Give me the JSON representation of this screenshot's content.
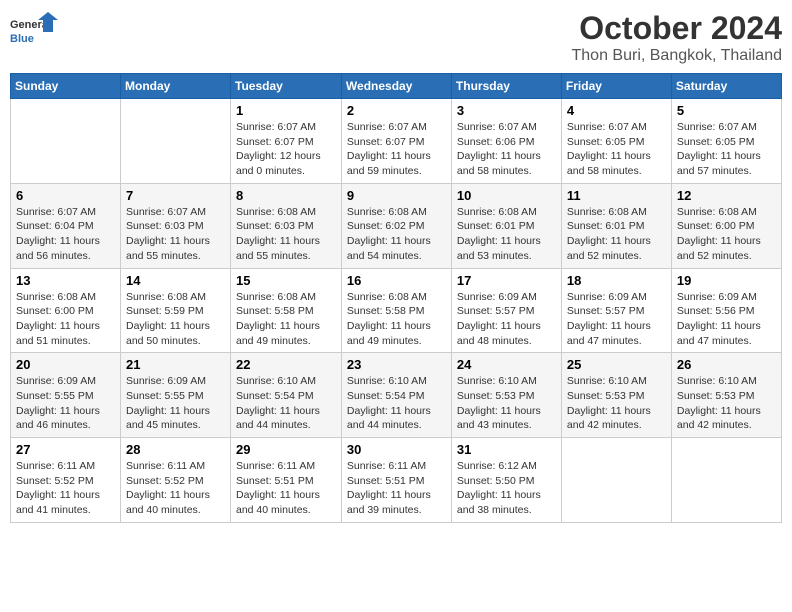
{
  "header": {
    "logo_line1": "General",
    "logo_line2": "Blue",
    "month": "October 2024",
    "location": "Thon Buri, Bangkok, Thailand"
  },
  "weekdays": [
    "Sunday",
    "Monday",
    "Tuesday",
    "Wednesday",
    "Thursday",
    "Friday",
    "Saturday"
  ],
  "weeks": [
    [
      {
        "day": "",
        "info": ""
      },
      {
        "day": "",
        "info": ""
      },
      {
        "day": "1",
        "info": "Sunrise: 6:07 AM\nSunset: 6:07 PM\nDaylight: 12 hours\nand 0 minutes."
      },
      {
        "day": "2",
        "info": "Sunrise: 6:07 AM\nSunset: 6:07 PM\nDaylight: 11 hours\nand 59 minutes."
      },
      {
        "day": "3",
        "info": "Sunrise: 6:07 AM\nSunset: 6:06 PM\nDaylight: 11 hours\nand 58 minutes."
      },
      {
        "day": "4",
        "info": "Sunrise: 6:07 AM\nSunset: 6:05 PM\nDaylight: 11 hours\nand 58 minutes."
      },
      {
        "day": "5",
        "info": "Sunrise: 6:07 AM\nSunset: 6:05 PM\nDaylight: 11 hours\nand 57 minutes."
      }
    ],
    [
      {
        "day": "6",
        "info": "Sunrise: 6:07 AM\nSunset: 6:04 PM\nDaylight: 11 hours\nand 56 minutes."
      },
      {
        "day": "7",
        "info": "Sunrise: 6:07 AM\nSunset: 6:03 PM\nDaylight: 11 hours\nand 55 minutes."
      },
      {
        "day": "8",
        "info": "Sunrise: 6:08 AM\nSunset: 6:03 PM\nDaylight: 11 hours\nand 55 minutes."
      },
      {
        "day": "9",
        "info": "Sunrise: 6:08 AM\nSunset: 6:02 PM\nDaylight: 11 hours\nand 54 minutes."
      },
      {
        "day": "10",
        "info": "Sunrise: 6:08 AM\nSunset: 6:01 PM\nDaylight: 11 hours\nand 53 minutes."
      },
      {
        "day": "11",
        "info": "Sunrise: 6:08 AM\nSunset: 6:01 PM\nDaylight: 11 hours\nand 52 minutes."
      },
      {
        "day": "12",
        "info": "Sunrise: 6:08 AM\nSunset: 6:00 PM\nDaylight: 11 hours\nand 52 minutes."
      }
    ],
    [
      {
        "day": "13",
        "info": "Sunrise: 6:08 AM\nSunset: 6:00 PM\nDaylight: 11 hours\nand 51 minutes."
      },
      {
        "day": "14",
        "info": "Sunrise: 6:08 AM\nSunset: 5:59 PM\nDaylight: 11 hours\nand 50 minutes."
      },
      {
        "day": "15",
        "info": "Sunrise: 6:08 AM\nSunset: 5:58 PM\nDaylight: 11 hours\nand 49 minutes."
      },
      {
        "day": "16",
        "info": "Sunrise: 6:08 AM\nSunset: 5:58 PM\nDaylight: 11 hours\nand 49 minutes."
      },
      {
        "day": "17",
        "info": "Sunrise: 6:09 AM\nSunset: 5:57 PM\nDaylight: 11 hours\nand 48 minutes."
      },
      {
        "day": "18",
        "info": "Sunrise: 6:09 AM\nSunset: 5:57 PM\nDaylight: 11 hours\nand 47 minutes."
      },
      {
        "day": "19",
        "info": "Sunrise: 6:09 AM\nSunset: 5:56 PM\nDaylight: 11 hours\nand 47 minutes."
      }
    ],
    [
      {
        "day": "20",
        "info": "Sunrise: 6:09 AM\nSunset: 5:55 PM\nDaylight: 11 hours\nand 46 minutes."
      },
      {
        "day": "21",
        "info": "Sunrise: 6:09 AM\nSunset: 5:55 PM\nDaylight: 11 hours\nand 45 minutes."
      },
      {
        "day": "22",
        "info": "Sunrise: 6:10 AM\nSunset: 5:54 PM\nDaylight: 11 hours\nand 44 minutes."
      },
      {
        "day": "23",
        "info": "Sunrise: 6:10 AM\nSunset: 5:54 PM\nDaylight: 11 hours\nand 44 minutes."
      },
      {
        "day": "24",
        "info": "Sunrise: 6:10 AM\nSunset: 5:53 PM\nDaylight: 11 hours\nand 43 minutes."
      },
      {
        "day": "25",
        "info": "Sunrise: 6:10 AM\nSunset: 5:53 PM\nDaylight: 11 hours\nand 42 minutes."
      },
      {
        "day": "26",
        "info": "Sunrise: 6:10 AM\nSunset: 5:53 PM\nDaylight: 11 hours\nand 42 minutes."
      }
    ],
    [
      {
        "day": "27",
        "info": "Sunrise: 6:11 AM\nSunset: 5:52 PM\nDaylight: 11 hours\nand 41 minutes."
      },
      {
        "day": "28",
        "info": "Sunrise: 6:11 AM\nSunset: 5:52 PM\nDaylight: 11 hours\nand 40 minutes."
      },
      {
        "day": "29",
        "info": "Sunrise: 6:11 AM\nSunset: 5:51 PM\nDaylight: 11 hours\nand 40 minutes."
      },
      {
        "day": "30",
        "info": "Sunrise: 6:11 AM\nSunset: 5:51 PM\nDaylight: 11 hours\nand 39 minutes."
      },
      {
        "day": "31",
        "info": "Sunrise: 6:12 AM\nSunset: 5:50 PM\nDaylight: 11 hours\nand 38 minutes."
      },
      {
        "day": "",
        "info": ""
      },
      {
        "day": "",
        "info": ""
      }
    ]
  ]
}
